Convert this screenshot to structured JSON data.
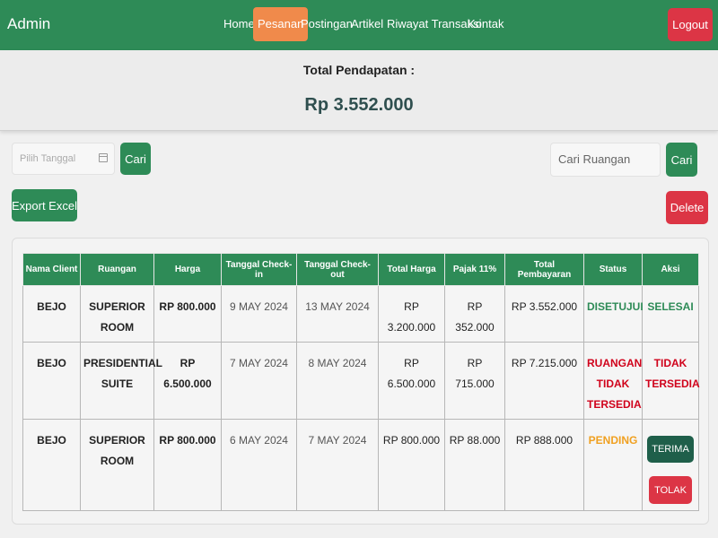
{
  "nav": {
    "brand": "Admin",
    "items": [
      {
        "label": "Home"
      },
      {
        "label": "Pesanan"
      },
      {
        "label": "Postingan"
      },
      {
        "label": "Artikel"
      },
      {
        "label": "Riwayat Transaksi"
      },
      {
        "label": "Kontak"
      }
    ],
    "active": "Pesanan",
    "logout": "Logout"
  },
  "revenue": {
    "label": "Total Pendapatan :",
    "value": "Rp 3.552.000"
  },
  "filters": {
    "date_placeholder": "Pilih Tanggal",
    "date_search": "Cari",
    "room_placeholder": "Cari Ruangan",
    "room_search": "Cari",
    "export": "Export Excel",
    "delete": "Delete"
  },
  "table": {
    "headers": [
      "Nama Client",
      "Ruangan",
      "Harga",
      "Tanggal Check-in",
      "Tanggal Check-out",
      "Total Harga",
      "Pajak 11%",
      "Total Pembayaran",
      "Status",
      "Aksi"
    ],
    "rows": [
      {
        "client": "BEJO",
        "room": "SUPERIOR ROOM",
        "price": "RP 800.000",
        "checkin": "9 MAY 2024",
        "checkout": "13 MAY 2024",
        "total": "RP 3.200.000",
        "tax": "RP 352.000",
        "payment": "RP 3.552.000",
        "status": "DISETUJUI",
        "action": "SELESAI"
      },
      {
        "client": "BEJO",
        "room": "PRESIDENTIAL SUITE",
        "price": "RP 6.500.000",
        "checkin": "7 MAY 2024",
        "checkout": "8 MAY 2024",
        "total": "RP 6.500.000",
        "tax": "RP 715.000",
        "payment": "RP 7.215.000",
        "status": "RUANGAN TIDAK TERSEDIA",
        "action": "TIDAK TERSEDIA"
      },
      {
        "client": "BEJO",
        "room": "SUPERIOR ROOM",
        "price": "RP 800.000",
        "checkin": "6 MAY 2024",
        "checkout": "7 MAY 2024",
        "total": "RP 800.000",
        "tax": "RP 88.000",
        "payment": "RP 888.000",
        "status": "PENDING",
        "actions": [
          "TERIMA",
          "TOLAK"
        ]
      }
    ]
  },
  "colors": {
    "primary": "#2e8b57",
    "active_nav": "#f08a4b",
    "danger": "#dc3545",
    "approved": "#2e8b57",
    "unavailable": "#d0021b",
    "pending": "#f0a020"
  }
}
